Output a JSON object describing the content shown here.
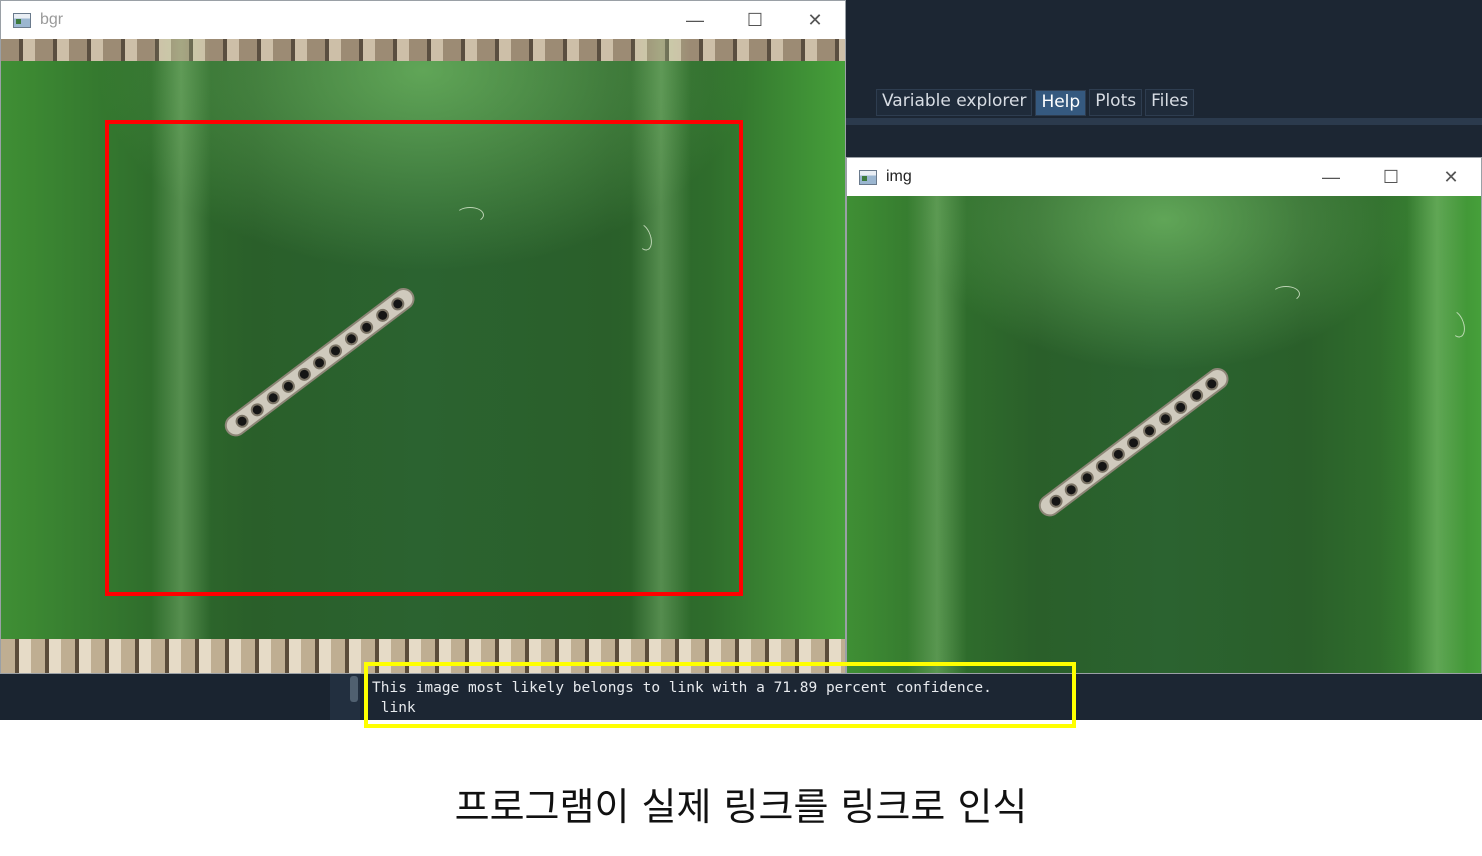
{
  "ide": {
    "tabs": [
      {
        "label": "Variable explorer"
      },
      {
        "label": "Help"
      },
      {
        "label": "Plots"
      },
      {
        "label": "Files"
      }
    ],
    "active_tab": "Help"
  },
  "windows": {
    "bgr": {
      "title": "bgr"
    },
    "img": {
      "title": "img"
    }
  },
  "window_controls": {
    "minimize": "—",
    "maximize": "☐",
    "close": "✕"
  },
  "console": {
    "line1": "This image most likely belongs to link with a 71.89 percent confidence.",
    "line2": " link"
  },
  "caption": "프로그램이 실제 링크를 링크로 인식",
  "colors": {
    "detection_box": "#ff0000",
    "highlight_box": "#ffff00",
    "ide_background": "#1c2633"
  },
  "icons": [
    "app-window-icon",
    "minimize-icon",
    "maximize-icon",
    "close-icon"
  ]
}
